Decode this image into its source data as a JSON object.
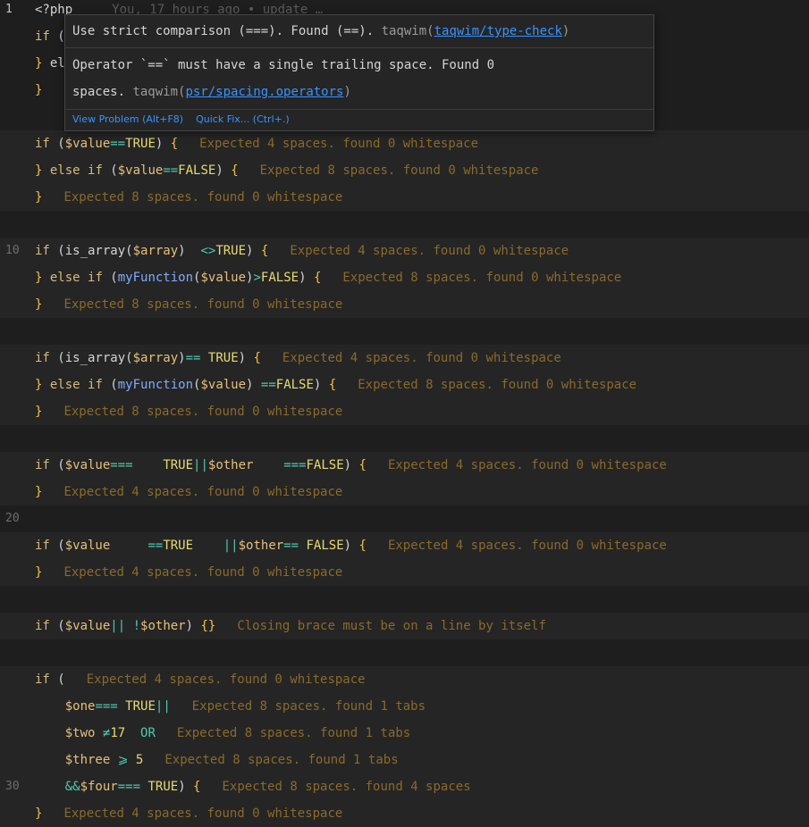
{
  "line_numbers": [
    "1",
    "10",
    "20",
    "30"
  ],
  "blame": "You, 17 hours ago • update …",
  "lines": [
    {
      "gutter": "1",
      "active": true,
      "hl": false,
      "parts": [
        [
          "plain",
          "<?php"
        ]
      ],
      "ghost": true
    },
    {
      "gutter": "",
      "hl": false,
      "parts": [
        [
          "kw-y",
          "if"
        ],
        [
          "plain",
          " ("
        ]
      ]
    },
    {
      "gutter": "",
      "hl": false,
      "parts": [
        [
          "brace",
          "}"
        ],
        [
          "plain",
          " el"
        ]
      ]
    },
    {
      "gutter": "",
      "hl": false,
      "parts": [
        [
          "brace",
          "}"
        ]
      ]
    },
    {
      "gutter": "",
      "hl": false,
      "parts": []
    },
    {
      "gutter": "",
      "hl": true,
      "parts": [
        [
          "kw-y",
          "if"
        ],
        [
          "plain",
          " ("
        ],
        [
          "var",
          "$value"
        ],
        [
          "op",
          "=="
        ],
        [
          "const",
          "TRUE"
        ],
        [
          "plain",
          ") "
        ],
        [
          "brace",
          "{"
        ]
      ],
      "hint": "Expected 4 spaces. found 0 whitespace"
    },
    {
      "gutter": "",
      "hl": true,
      "parts": [
        [
          "brace",
          "}"
        ],
        [
          "kw-y",
          " else if"
        ],
        [
          "plain",
          " ("
        ],
        [
          "var",
          "$value"
        ],
        [
          "op",
          "=="
        ],
        [
          "const",
          "FALSE"
        ],
        [
          "plain",
          ") "
        ],
        [
          "brace",
          "{"
        ]
      ],
      "hint": "Expected 8 spaces. found 0 whitespace"
    },
    {
      "gutter": "",
      "hl": true,
      "parts": [
        [
          "brace",
          "}"
        ]
      ],
      "hint": "Expected 8 spaces. found 0 whitespace"
    },
    {
      "gutter": "",
      "hl": false,
      "parts": []
    },
    {
      "gutter": "10",
      "hl": true,
      "parts": [
        [
          "kw-y",
          "if"
        ],
        [
          "plain",
          " ("
        ],
        [
          "plain",
          "is_array"
        ],
        [
          "plain",
          "("
        ],
        [
          "var",
          "$array"
        ],
        [
          "plain",
          ")  "
        ],
        [
          "op",
          "<>"
        ],
        [
          "const",
          "TRUE"
        ],
        [
          "plain",
          ") "
        ],
        [
          "brace",
          "{"
        ]
      ],
      "hint": "Expected 4 spaces. found 0 whitespace"
    },
    {
      "gutter": "",
      "hl": true,
      "parts": [
        [
          "brace",
          "}"
        ],
        [
          "kw-y",
          " else if"
        ],
        [
          "plain",
          " ("
        ],
        [
          "fn",
          "myFunction"
        ],
        [
          "plain",
          "("
        ],
        [
          "var",
          "$value"
        ],
        [
          "plain",
          ")"
        ],
        [
          "op",
          ">"
        ],
        [
          "const",
          "FALSE"
        ],
        [
          "plain",
          ") "
        ],
        [
          "brace",
          "{"
        ]
      ],
      "hint": "Expected 8 spaces. found 0 whitespace"
    },
    {
      "gutter": "",
      "hl": true,
      "parts": [
        [
          "brace",
          "}"
        ]
      ],
      "hint": "Expected 8 spaces. found 0 whitespace"
    },
    {
      "gutter": "",
      "hl": false,
      "parts": []
    },
    {
      "gutter": "",
      "hl": true,
      "parts": [
        [
          "kw-y",
          "if"
        ],
        [
          "plain",
          " ("
        ],
        [
          "plain",
          "is_array"
        ],
        [
          "plain",
          "("
        ],
        [
          "var",
          "$array"
        ],
        [
          "plain",
          ")"
        ],
        [
          "op",
          "=="
        ],
        [
          "plain",
          " "
        ],
        [
          "const",
          "TRUE"
        ],
        [
          "plain",
          ") "
        ],
        [
          "brace",
          "{"
        ]
      ],
      "hint": "Expected 4 spaces. found 0 whitespace"
    },
    {
      "gutter": "",
      "hl": true,
      "parts": [
        [
          "brace",
          "}"
        ],
        [
          "kw-y",
          " else if"
        ],
        [
          "plain",
          " ("
        ],
        [
          "fn",
          "myFunction"
        ],
        [
          "plain",
          "("
        ],
        [
          "var",
          "$value"
        ],
        [
          "plain",
          ") "
        ],
        [
          "op",
          "=="
        ],
        [
          "const",
          "FALSE"
        ],
        [
          "plain",
          ") "
        ],
        [
          "brace",
          "{"
        ]
      ],
      "hint": "Expected 8 spaces. found 0 whitespace"
    },
    {
      "gutter": "",
      "hl": true,
      "parts": [
        [
          "brace",
          "}"
        ]
      ],
      "hint": "Expected 8 spaces. found 0 whitespace"
    },
    {
      "gutter": "",
      "hl": false,
      "parts": []
    },
    {
      "gutter": "",
      "hl": true,
      "parts": [
        [
          "kw-y",
          "if"
        ],
        [
          "plain",
          " ("
        ],
        [
          "var",
          "$value"
        ],
        [
          "op",
          "==="
        ],
        [
          "plain",
          "    "
        ],
        [
          "const",
          "TRUE"
        ],
        [
          "op",
          "||"
        ],
        [
          "var",
          "$other"
        ],
        [
          "plain",
          "    "
        ],
        [
          "op",
          "==="
        ],
        [
          "const",
          "FALSE"
        ],
        [
          "plain",
          ") "
        ],
        [
          "brace",
          "{"
        ]
      ],
      "hint": "Expected 4 spaces. found 0 whitespace"
    },
    {
      "gutter": "",
      "hl": true,
      "parts": [
        [
          "brace",
          "}"
        ]
      ],
      "hint": "Expected 4 spaces. found 0 whitespace"
    },
    {
      "gutter": "20",
      "hl": false,
      "parts": []
    },
    {
      "gutter": "",
      "hl": true,
      "parts": [
        [
          "kw-y",
          "if"
        ],
        [
          "plain",
          " ("
        ],
        [
          "var",
          "$value"
        ],
        [
          "plain",
          "     "
        ],
        [
          "op",
          "=="
        ],
        [
          "const",
          "TRUE"
        ],
        [
          "plain",
          "    "
        ],
        [
          "op",
          "||"
        ],
        [
          "var",
          "$other"
        ],
        [
          "op",
          "=="
        ],
        [
          "plain",
          " "
        ],
        [
          "const",
          "FALSE"
        ],
        [
          "plain",
          ") "
        ],
        [
          "brace",
          "{"
        ]
      ],
      "hint": "Expected 4 spaces. found 0 whitespace"
    },
    {
      "gutter": "",
      "hl": true,
      "parts": [
        [
          "brace",
          "}"
        ]
      ],
      "hint": "Expected 4 spaces. found 0 whitespace"
    },
    {
      "gutter": "",
      "hl": false,
      "parts": []
    },
    {
      "gutter": "",
      "hl": true,
      "parts": [
        [
          "kw-y",
          "if"
        ],
        [
          "plain",
          " ("
        ],
        [
          "var",
          "$value"
        ],
        [
          "op",
          "||"
        ],
        [
          "plain",
          " "
        ],
        [
          "op",
          "!"
        ],
        [
          "var",
          "$other"
        ],
        [
          "plain",
          ") "
        ],
        [
          "brace",
          "{}"
        ]
      ],
      "hint": "Closing brace must be on a line by itself"
    },
    {
      "gutter": "",
      "hl": false,
      "parts": []
    },
    {
      "gutter": "",
      "hl": true,
      "parts": [
        [
          "kw-y",
          "if"
        ],
        [
          "plain",
          " ("
        ]
      ],
      "hint": "Expected 4 spaces. found 0 whitespace"
    },
    {
      "gutter": "",
      "hl": true,
      "parts": [
        [
          "plain",
          "    "
        ],
        [
          "var",
          "$one"
        ],
        [
          "op",
          "==="
        ],
        [
          "plain",
          " "
        ],
        [
          "const",
          "TRUE"
        ],
        [
          "op",
          "||"
        ]
      ],
      "hint": "Expected 8 spaces. found 1 tabs"
    },
    {
      "gutter": "",
      "hl": true,
      "parts": [
        [
          "plain",
          "    "
        ],
        [
          "var",
          "$two"
        ],
        [
          "plain",
          " "
        ],
        [
          "op",
          "≠"
        ],
        [
          "const",
          "17"
        ],
        [
          "plain",
          "  "
        ],
        [
          "op",
          "OR"
        ]
      ],
      "hint": "Expected 8 spaces. found 1 tabs"
    },
    {
      "gutter": "",
      "hl": true,
      "parts": [
        [
          "plain",
          "    "
        ],
        [
          "var",
          "$three"
        ],
        [
          "plain",
          " "
        ],
        [
          "op",
          "⩾"
        ],
        [
          "plain",
          " "
        ],
        [
          "const",
          "5"
        ]
      ],
      "hint": "Expected 8 spaces. found 1 tabs"
    },
    {
      "gutter": "30",
      "hl": true,
      "parts": [
        [
          "plain",
          "    "
        ],
        [
          "op",
          "&&"
        ],
        [
          "var",
          "$four"
        ],
        [
          "op",
          "==="
        ],
        [
          "plain",
          " "
        ],
        [
          "const",
          "TRUE"
        ],
        [
          "plain",
          ") "
        ],
        [
          "brace",
          "{"
        ]
      ],
      "hint": "Expected 8 spaces. found 4 spaces"
    },
    {
      "gutter": "",
      "hl": true,
      "parts": [
        [
          "brace",
          "}"
        ]
      ],
      "hint": "Expected 4 spaces. found 0 whitespace"
    }
  ],
  "hover": {
    "msg1_prefix": "Use strict comparison (===). Found (==). ",
    "msg1_source": "taqwim(",
    "msg1_link": "taqwim/type-check",
    "msg1_suffix": ")",
    "msg2_line1": "Operator `==` must have a single trailing space. Found 0",
    "msg2_prefix": "spaces. ",
    "msg2_source": "taqwim(",
    "msg2_link": "psr/spacing.operators",
    "msg2_suffix": ")",
    "view_problem": "View Problem (Alt+F8)",
    "quick_fix": "Quick Fix... (Ctrl+.)"
  }
}
